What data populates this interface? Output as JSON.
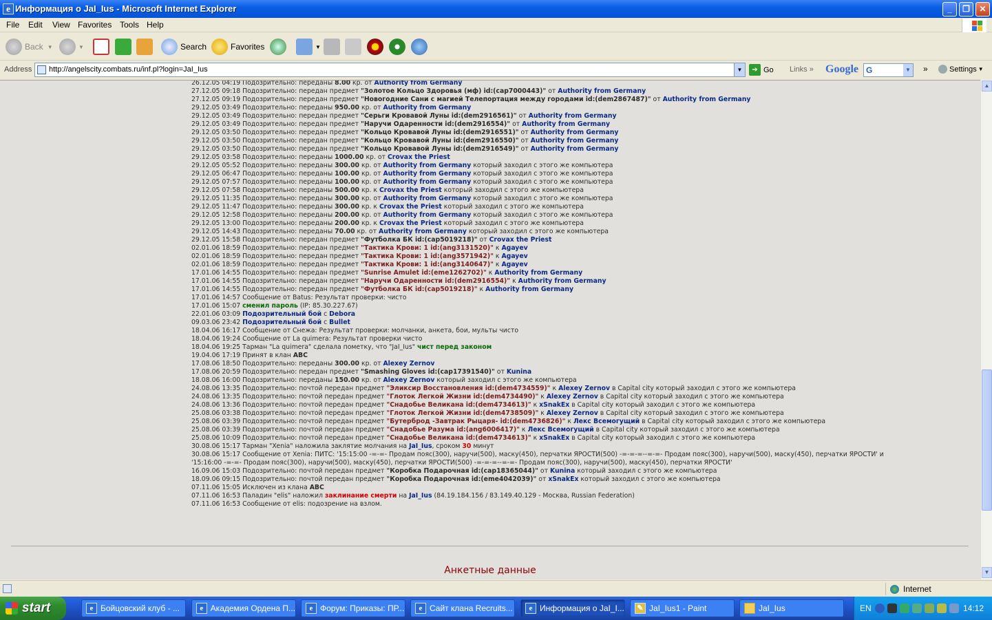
{
  "window": {
    "title": "Информация о JaI_Ius - Microsoft Internet Explorer"
  },
  "menu": [
    "File",
    "Edit",
    "View",
    "Favorites",
    "Tools",
    "Help"
  ],
  "toolbar": {
    "back": "Back",
    "search": "Search",
    "favorites": "Favorites"
  },
  "addressbar": {
    "label": "Address",
    "url": "http://angelscity.combats.ru/inf.pl?login=JaI_Ius",
    "go": "Go",
    "links": "Links",
    "google": "Google",
    "google_box": "G",
    "settings": "Settings"
  },
  "log": [
    [
      {
        "t": "26.12.05 04:19 Подозрительно: переданы "
      },
      {
        "t": "8.00",
        "c": "b"
      },
      {
        "t": " кр. от "
      },
      {
        "t": "Authority from Germany",
        "c": "nick"
      }
    ],
    [
      {
        "t": "27.12.05 09:18 Подозрительно: передан предмет "
      },
      {
        "t": "\"Золотое Кольцо Здоровья (мф) id:(cap7000443)\"",
        "c": "b"
      },
      {
        "t": " от "
      },
      {
        "t": "Authority from Germany",
        "c": "nick"
      }
    ],
    [
      {
        "t": "27.12.05 09:19 Подозрительно: передан предмет "
      },
      {
        "t": "\"Новогодние Сани с магией Телепортация между городами id:(dem2867487)\"",
        "c": "b"
      },
      {
        "t": " от "
      },
      {
        "t": "Authority from Germany",
        "c": "nick"
      }
    ],
    [
      {
        "t": "29.12.05 03:49 Подозрительно: переданы "
      },
      {
        "t": "950.00",
        "c": "b"
      },
      {
        "t": " кр. от "
      },
      {
        "t": "Authority from Germany",
        "c": "nick"
      }
    ],
    [
      {
        "t": "29.12.05 03:49 Подозрительно: передан предмет "
      },
      {
        "t": "\"Серьги Кровавой Луны id:(dem2916561)\"",
        "c": "b"
      },
      {
        "t": " от "
      },
      {
        "t": "Authority from Germany",
        "c": "nick"
      }
    ],
    [
      {
        "t": "29.12.05 03:49 Подозрительно: передан предмет "
      },
      {
        "t": "\"Наручи Одаренности id:(dem2916554)\"",
        "c": "b"
      },
      {
        "t": " от "
      },
      {
        "t": "Authority from Germany",
        "c": "nick"
      }
    ],
    [
      {
        "t": "29.12.05 03:50 Подозрительно: передан предмет "
      },
      {
        "t": "\"Кольцо Кровавой Луны id:(dem2916551)\"",
        "c": "b"
      },
      {
        "t": " от "
      },
      {
        "t": "Authority from Germany",
        "c": "nick"
      }
    ],
    [
      {
        "t": "29.12.05 03:50 Подозрительно: передан предмет "
      },
      {
        "t": "\"Кольцо Кровавой Луны id:(dem2916550)\"",
        "c": "b"
      },
      {
        "t": " от "
      },
      {
        "t": "Authority from Germany",
        "c": "nick"
      }
    ],
    [
      {
        "t": "29.12.05 03:50 Подозрительно: передан предмет "
      },
      {
        "t": "\"Кольцо Кровавой Луны id:(dem2916549)\"",
        "c": "b"
      },
      {
        "t": " от "
      },
      {
        "t": "Authority from Germany",
        "c": "nick"
      }
    ],
    [
      {
        "t": "29.12.05 03:58 Подозрительно: переданы "
      },
      {
        "t": "1000.00",
        "c": "b"
      },
      {
        "t": " кр. от "
      },
      {
        "t": "Crovax the Priest",
        "c": "nick"
      }
    ],
    [
      {
        "t": "29.12.05 05:52 Подозрительно: переданы "
      },
      {
        "t": "300.00",
        "c": "b"
      },
      {
        "t": " кр. от "
      },
      {
        "t": "Authority from Germany",
        "c": "nick"
      },
      {
        "t": " который заходил с этого же компьютера"
      }
    ],
    [
      {
        "t": "29.12.05 06:47 Подозрительно: переданы "
      },
      {
        "t": "100.00",
        "c": "b"
      },
      {
        "t": " кр. от "
      },
      {
        "t": "Authority from Germany",
        "c": "nick"
      },
      {
        "t": " который заходил с этого же компьютера"
      }
    ],
    [
      {
        "t": "29.12.05 07:57 Подозрительно: переданы "
      },
      {
        "t": "100.00",
        "c": "b"
      },
      {
        "t": " кр. от "
      },
      {
        "t": "Authority from Germany",
        "c": "nick"
      },
      {
        "t": " который заходил с этого же компьютера"
      }
    ],
    [
      {
        "t": "29.12.05 07:58 Подозрительно: переданы "
      },
      {
        "t": "500.00",
        "c": "b"
      },
      {
        "t": " кр. к "
      },
      {
        "t": "Crovax the Priest",
        "c": "nick"
      },
      {
        "t": " который заходил с этого же компьютера"
      }
    ],
    [
      {
        "t": "29.12.05 11:35 Подозрительно: переданы "
      },
      {
        "t": "300.00",
        "c": "b"
      },
      {
        "t": " кр. от "
      },
      {
        "t": "Authority from Germany",
        "c": "nick"
      },
      {
        "t": " который заходил с этого же компьютера"
      }
    ],
    [
      {
        "t": "29.12.05 11:47 Подозрительно: переданы "
      },
      {
        "t": "300.00",
        "c": "b"
      },
      {
        "t": " кр. к "
      },
      {
        "t": "Crovax the Priest",
        "c": "nick"
      },
      {
        "t": " который заходил с этого же компьютера"
      }
    ],
    [
      {
        "t": "29.12.05 12:58 Подозрительно: переданы "
      },
      {
        "t": "200.00",
        "c": "b"
      },
      {
        "t": " кр. от "
      },
      {
        "t": "Authority from Germany",
        "c": "nick"
      },
      {
        "t": " который заходил с этого же компьютера"
      }
    ],
    [
      {
        "t": "29.12.05 13:00 Подозрительно: переданы "
      },
      {
        "t": "200.00",
        "c": "b"
      },
      {
        "t": " кр. к "
      },
      {
        "t": "Crovax the Priest",
        "c": "nick"
      },
      {
        "t": " который заходил с этого же компьютера"
      }
    ],
    [
      {
        "t": "29.12.05 14:43 Подозрительно: переданы "
      },
      {
        "t": "70.00",
        "c": "b"
      },
      {
        "t": " кр. от "
      },
      {
        "t": "Authority from Germany",
        "c": "nick"
      },
      {
        "t": " который заходил с этого же компьютера"
      }
    ],
    [
      {
        "t": "29.12.05 15:58 Подозрительно: передан предмет "
      },
      {
        "t": "\"Футболка БК id:(cap5019218)\"",
        "c": "b"
      },
      {
        "t": " от "
      },
      {
        "t": "Crovax the Priest",
        "c": "nick"
      }
    ],
    [
      {
        "t": "02.01.06 18:59 Подозрительно: передан предмет "
      },
      {
        "t": "\"Тактика Крови: 1 id:(ang3131520)\"",
        "c": "item"
      },
      {
        "t": " к "
      },
      {
        "t": "Agayev",
        "c": "nick"
      }
    ],
    [
      {
        "t": "02.01.06 18:59 Подозрительно: передан предмет "
      },
      {
        "t": "\"Тактика Крови: 1 id:(ang3571942)\"",
        "c": "item"
      },
      {
        "t": " к "
      },
      {
        "t": "Agayev",
        "c": "nick"
      }
    ],
    [
      {
        "t": "02.01.06 18:59 Подозрительно: передан предмет "
      },
      {
        "t": "\"Тактика Крови: 1 id:(ang3140647)\"",
        "c": "item"
      },
      {
        "t": " к "
      },
      {
        "t": "Agayev",
        "c": "nick"
      }
    ],
    [
      {
        "t": "17.01.06 14:55 Подозрительно: передан предмет "
      },
      {
        "t": "\"Sunrise Amulet id:(eme1262702)\"",
        "c": "item"
      },
      {
        "t": " к "
      },
      {
        "t": "Authority from Germany",
        "c": "nick"
      }
    ],
    [
      {
        "t": "17.01.06 14:55 Подозрительно: передан предмет "
      },
      {
        "t": "\"Наручи Одаренности id:(dem2916554)\"",
        "c": "item"
      },
      {
        "t": " к "
      },
      {
        "t": "Authority from Germany",
        "c": "nick"
      }
    ],
    [
      {
        "t": "17.01.06 14:55 Подозрительно: передан предмет "
      },
      {
        "t": "\"Футболка БК id:(cap5019218)\"",
        "c": "item"
      },
      {
        "t": " к "
      },
      {
        "t": "Authority from Germany",
        "c": "nick"
      }
    ],
    [
      {
        "t": "17.01.06 14:57 Сообщение от Batus: Результат проверки: чисто"
      }
    ],
    [
      {
        "t": "17.01.06 15:07 "
      },
      {
        "t": "сменил пароль",
        "c": "grn"
      },
      {
        "t": " (IP: 85.30.227.67)"
      }
    ],
    [
      {
        "t": "22.01.06 03:09 "
      },
      {
        "t": "Подозрительный бой",
        "c": "nick"
      },
      {
        "t": " с "
      },
      {
        "t": "Debora",
        "c": "nick"
      }
    ],
    [
      {
        "t": "09.03.06 23:42 "
      },
      {
        "t": "Подозрительный бой",
        "c": "nick"
      },
      {
        "t": " с "
      },
      {
        "t": "Bullet",
        "c": "nick"
      }
    ],
    [
      {
        "t": "18.04.06 16:17 Сообщение от Снежа: Результат проверки: молчанки, анкета, бои, мульты чисто"
      }
    ],
    [
      {
        "t": "18.04.06 19:24 Сообщение от La quimera: Результат проверки чисто"
      }
    ],
    [
      {
        "t": "18.04.06 19:25 Тарман \"La quimera\" сделала пометку, что \"JaI_Ius\" "
      },
      {
        "t": "чист перед законом",
        "c": "grn"
      }
    ],
    [
      {
        "t": "19.04.06 17:19 Принят в клан "
      },
      {
        "t": "ABC",
        "c": "b"
      }
    ],
    [
      {
        "t": "17.08.06 18:50 Подозрительно: переданы "
      },
      {
        "t": "300.00",
        "c": "b"
      },
      {
        "t": " кр. от "
      },
      {
        "t": "Alexey Zernov",
        "c": "nick"
      }
    ],
    [
      {
        "t": "17.08.06 20:59 Подозрительно: передан предмет "
      },
      {
        "t": "\"Smashing Gloves id:(cap17391540)\"",
        "c": "b"
      },
      {
        "t": " от "
      },
      {
        "t": "Kunina",
        "c": "nick"
      }
    ],
    [
      {
        "t": "18.08.06 16:00 Подозрительно: переданы "
      },
      {
        "t": "150.00",
        "c": "b"
      },
      {
        "t": " кр. от "
      },
      {
        "t": "Alexey Zernov",
        "c": "nick"
      },
      {
        "t": " который заходил с этого же компьютера"
      }
    ],
    [
      {
        "t": "24.08.06 13:35 Подозрительно: почтой передан предмет "
      },
      {
        "t": "\"Эликсир Восстановления id:(dem4734559)\"",
        "c": "item"
      },
      {
        "t": " к "
      },
      {
        "t": "Alexey Zernov",
        "c": "nick"
      },
      {
        "t": " в Capital city который заходил с этого же компьютера"
      }
    ],
    [
      {
        "t": "24.08.06 13:35 Подозрительно: почтой передан предмет "
      },
      {
        "t": "\"Глоток Легкой Жизни id:(dem4734490)\"",
        "c": "item"
      },
      {
        "t": " к "
      },
      {
        "t": "Alexey Zernov",
        "c": "nick"
      },
      {
        "t": " в Capital city который заходил с этого же компьютера"
      }
    ],
    [
      {
        "t": "24.08.06 13:36 Подозрительно: почтой передан предмет "
      },
      {
        "t": "\"Снадобье Великана id:(dem4734613)\"",
        "c": "item"
      },
      {
        "t": " к "
      },
      {
        "t": "xSnakEx",
        "c": "nick"
      },
      {
        "t": " в Capital city который заходил с этого же компьютера"
      }
    ],
    [
      {
        "t": "25.08.06 03:38 Подозрительно: почтой передан предмет "
      },
      {
        "t": "\"Глоток Легкой Жизни id:(dem4738509)\"",
        "c": "item"
      },
      {
        "t": " к "
      },
      {
        "t": "Alexey Zernov",
        "c": "nick"
      },
      {
        "t": " в Capital city который заходил с этого же компьютера"
      }
    ],
    [
      {
        "t": "25.08.06 03:39 Подозрительно: почтой передан предмет "
      },
      {
        "t": "\"Бутерброд -Завтрак Рыцаря- id:(dem4736826)\"",
        "c": "item"
      },
      {
        "t": " к "
      },
      {
        "t": "Лекс Всемогущий",
        "c": "nick"
      },
      {
        "t": " в Capital city который заходил с этого же компьютера"
      }
    ],
    [
      {
        "t": "25.08.06 03:39 Подозрительно: почтой передан предмет "
      },
      {
        "t": "\"Снадобье Разума id:(ang6006417)\"",
        "c": "item"
      },
      {
        "t": " к "
      },
      {
        "t": "Лекс Всемогущий",
        "c": "nick"
      },
      {
        "t": " в Capital city который заходил с этого же компьютера"
      }
    ],
    [
      {
        "t": "25.08.06 10:09 Подозрительно: почтой передан предмет "
      },
      {
        "t": "\"Снадобье Великана id:(dem4734613)\"",
        "c": "item"
      },
      {
        "t": " к "
      },
      {
        "t": "xSnakEx",
        "c": "nick"
      },
      {
        "t": " в Capital city который заходил с этого же компьютера"
      }
    ],
    [
      {
        "t": "30.08.06 15:17 Тарман \"Xenia\" наложила заклятие молчания на "
      },
      {
        "t": "JaI_Ius",
        "c": "nick"
      },
      {
        "t": ", сроком "
      },
      {
        "t": "30",
        "c": "red"
      },
      {
        "t": " минут"
      }
    ],
    [
      {
        "t": "30.08.06 15:17 Сообщение от Xenia: ПИТС: '15:15:00 -=-=- Продам пояс(300), наручи(500), маску(450), перчатки ЯРОСТИ(500) -=-=-=--=-=- Продам пояс(300), наручи(500), маску(450), перчатки ЯРОСТИ' и '15:16:00 -=-=- Продам пояс(300), наручи(500), маску(450), перчатки ЯРОСТИ(500) -=-=-=--=-=- Продам пояс(300), наручи(500), маску(450), перчатки ЯРОСТИ'"
      }
    ],
    [
      {
        "t": "16.09.06 15:03 Подозрительно: почтой передан предмет "
      },
      {
        "t": "\"Коробка Подарочная id:(cap18365044)\"",
        "c": "b"
      },
      {
        "t": " от "
      },
      {
        "t": "Kunina",
        "c": "nick"
      },
      {
        "t": " который заходил с этого же компьютера"
      }
    ],
    [
      {
        "t": "18.09.06 09:15 Подозрительно: почтой передан предмет "
      },
      {
        "t": "\"Коробка Подарочная id:(eme4042039)\"",
        "c": "b"
      },
      {
        "t": " от "
      },
      {
        "t": "xSnakEx",
        "c": "nick"
      },
      {
        "t": " который заходил с этого же компьютера"
      }
    ],
    [
      {
        "t": "07.11.06 15:05 Исключен из клана "
      },
      {
        "t": "ABC",
        "c": "b"
      }
    ],
    [
      {
        "t": "07.11.06 16:53 Паладин \"elis\" наложил "
      },
      {
        "t": "заклинание смерти",
        "c": "red"
      },
      {
        "t": " на "
      },
      {
        "t": "JaI_Ius",
        "c": "nick"
      },
      {
        "t": " (84.19.184.156 / 83.149.40.129 - Москва, Russian Federation)"
      }
    ],
    [
      {
        "t": "07.11.06 16:53 Сообщение от elis: подозрение на взлом."
      }
    ]
  ],
  "section": {
    "anket_title": "Анкетные данные"
  },
  "status": {
    "zone": "Internet"
  },
  "taskbar": {
    "start": "start",
    "tasks": [
      "Бойцовский клуб - ...",
      "Академия Ордена П...",
      "Форум: Приказы: ПР...",
      "Сайт клана Recruits...",
      "Информация о JaI_I...",
      "JaI_Ius1 - Paint",
      "JaI_Ius"
    ],
    "lang": "EN",
    "clock": "14:12"
  }
}
